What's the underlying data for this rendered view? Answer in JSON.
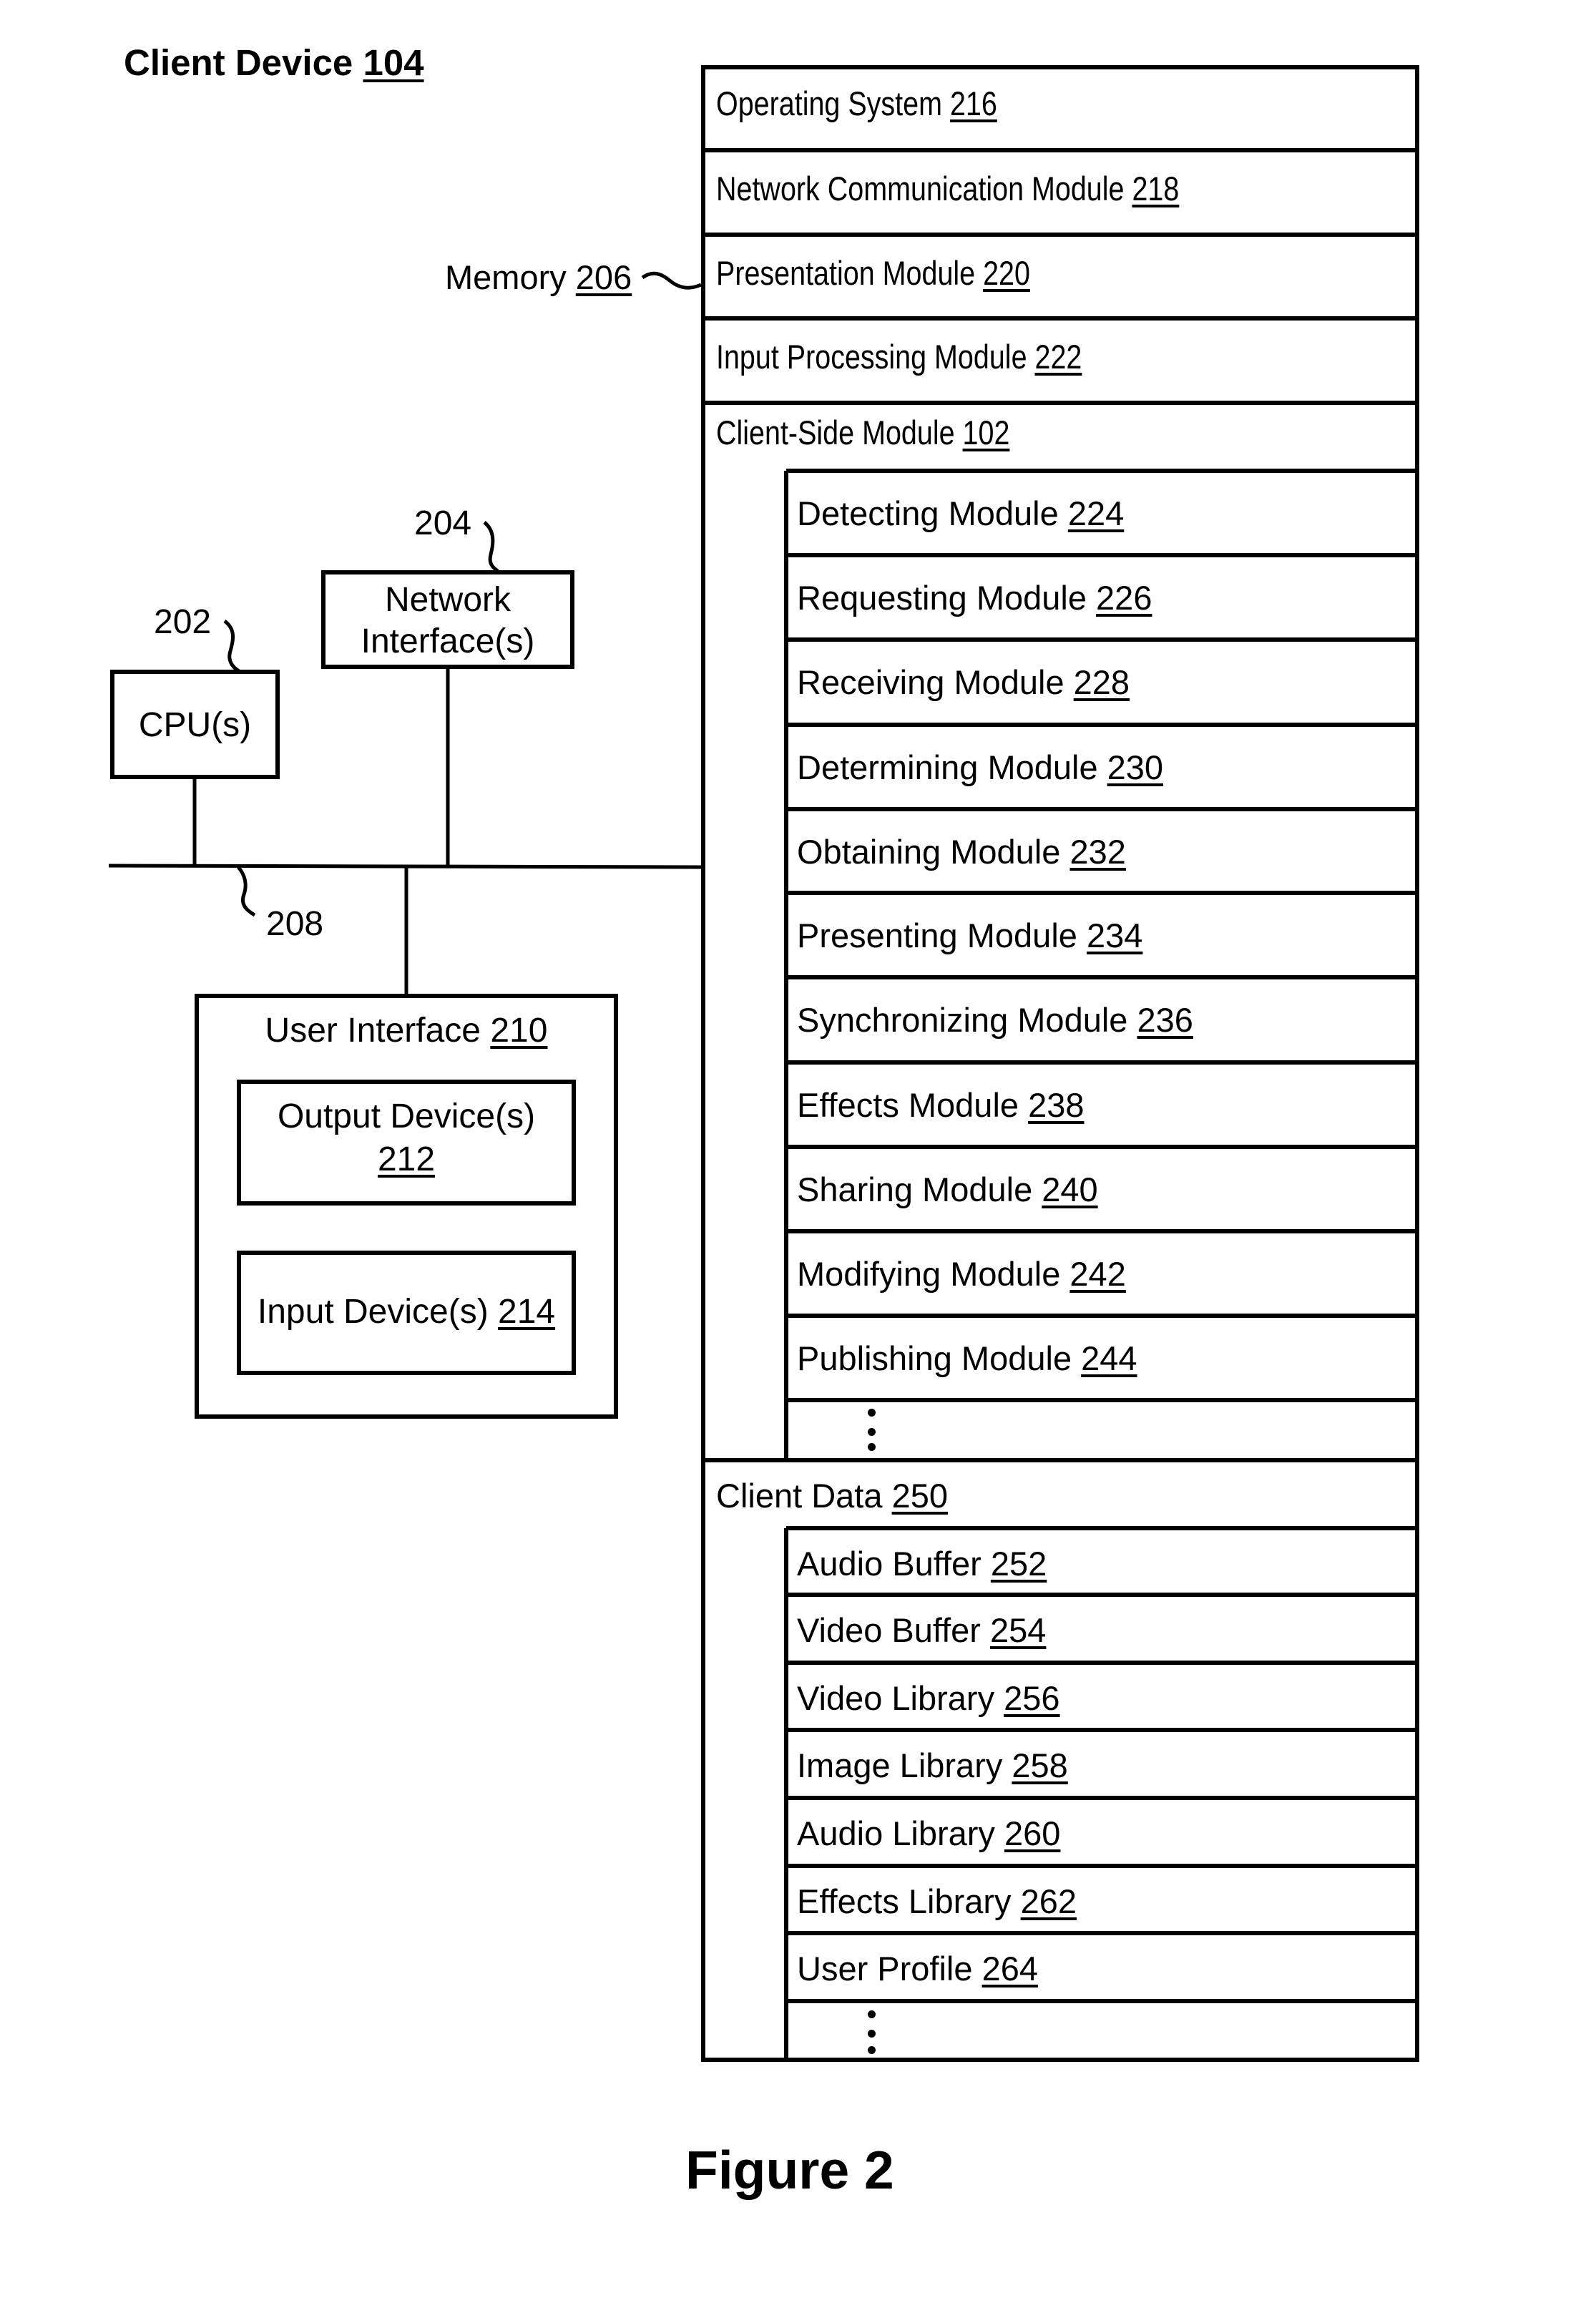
{
  "figure": {
    "title_text": "Client Device ",
    "title_ref": "104",
    "caption": "Figure 2"
  },
  "memory": {
    "label_text": "Memory ",
    "label_ref": "206",
    "top_rows": [
      {
        "text": "Operating System ",
        "ref": "216"
      },
      {
        "text": "Network Communication Module ",
        "ref": "218"
      },
      {
        "text": "Presentation Module ",
        "ref": "220"
      },
      {
        "text": "Input Processing Module ",
        "ref": "222"
      }
    ],
    "client_side_module": {
      "text": "Client-Side Module ",
      "ref": "102",
      "modules": [
        {
          "text": "Detecting Module ",
          "ref": "224"
        },
        {
          "text": "Requesting Module ",
          "ref": "226"
        },
        {
          "text": "Receiving Module ",
          "ref": "228"
        },
        {
          "text": "Determining Module ",
          "ref": "230"
        },
        {
          "text": "Obtaining Module ",
          "ref": "232"
        },
        {
          "text": "Presenting Module ",
          "ref": "234"
        },
        {
          "text": "Synchronizing Module ",
          "ref": "236"
        },
        {
          "text": "Effects Module ",
          "ref": "238"
        },
        {
          "text": "Sharing Module ",
          "ref": "240"
        },
        {
          "text": "Modifying Module ",
          "ref": "242"
        },
        {
          "text": "Publishing Module ",
          "ref": "244"
        }
      ]
    },
    "client_data": {
      "text": "Client Data ",
      "ref": "250",
      "items": [
        {
          "text": "Audio Buffer ",
          "ref": "252"
        },
        {
          "text": "Video Buffer ",
          "ref": "254"
        },
        {
          "text": "Video Library ",
          "ref": "256"
        },
        {
          "text": "Image Library ",
          "ref": "258"
        },
        {
          "text": "Audio Library ",
          "ref": "260"
        },
        {
          "text": "Effects Library ",
          "ref": "262"
        },
        {
          "text": "User Profile ",
          "ref": "264"
        }
      ]
    }
  },
  "cpu": {
    "label": "CPU(s)",
    "ref": "202"
  },
  "network_interface": {
    "line1": "Network",
    "line2": "Interface(s)",
    "ref": "204"
  },
  "bus": {
    "ref": "208"
  },
  "user_interface": {
    "text": "User Interface ",
    "ref": "210",
    "output_device": {
      "text": "Output Device(s)",
      "ref": "212"
    },
    "input_device": {
      "text": "Input Device(s) ",
      "ref": "214"
    }
  }
}
